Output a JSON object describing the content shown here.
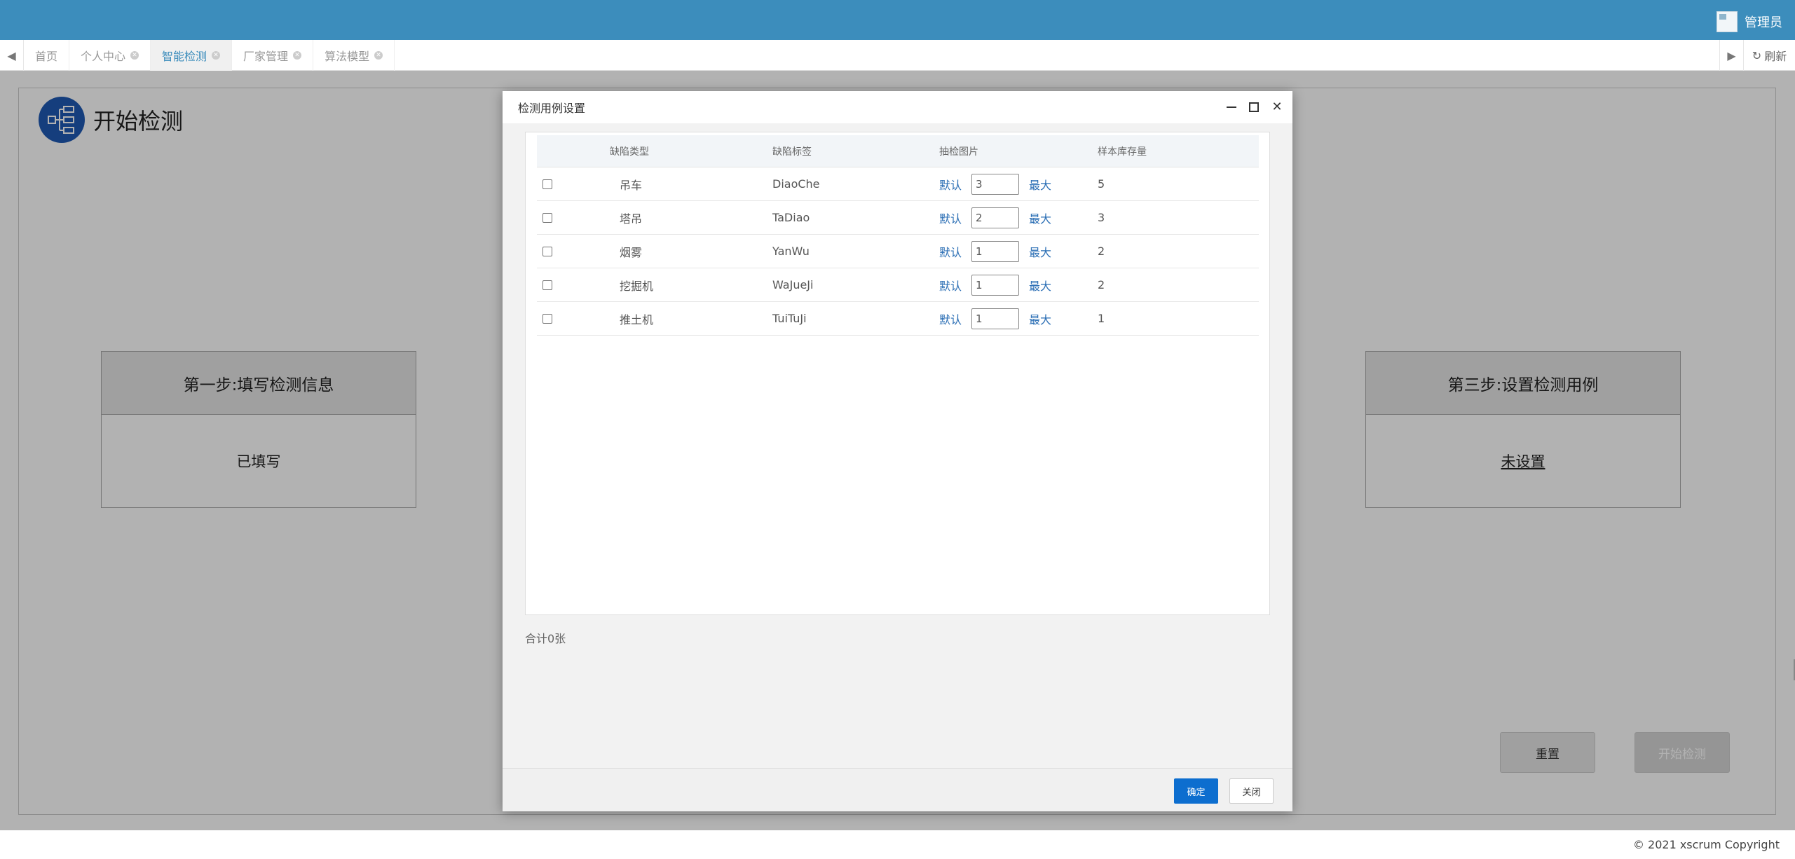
{
  "header": {
    "user_name": "管理员"
  },
  "tabbar": {
    "tabs": [
      {
        "label": "首页"
      },
      {
        "label": "个人中心"
      },
      {
        "label": "智能检测"
      },
      {
        "label": "厂家管理"
      },
      {
        "label": "算法模型"
      }
    ],
    "active_tab": "智能检测",
    "refresh_label": "刷新"
  },
  "main": {
    "title": "开始检测",
    "step1": {
      "title": "第一步:填写检测信息",
      "status": "已填写"
    },
    "step3": {
      "title": "第三步:设置检测用例",
      "status": "未设置"
    },
    "reset_label": "重置",
    "start_label": "开始检测"
  },
  "footer": {
    "copyright": "© 2021 xscrum Copyright"
  },
  "modal": {
    "title": "检测用例设置",
    "columns": {
      "type": "缺陷类型",
      "label": "缺陷标签",
      "sample": "抽检图片",
      "stock": "样本库存量"
    },
    "default_label": "默认",
    "max_label": "最大",
    "rows": [
      {
        "type": "吊车",
        "label": "DiaoChe",
        "sample": "3",
        "stock": "5"
      },
      {
        "type": "塔吊",
        "label": "TaDiao",
        "sample": "2",
        "stock": "3"
      },
      {
        "type": "烟雾",
        "label": "YanWu",
        "sample": "1",
        "stock": "2"
      },
      {
        "type": "挖掘机",
        "label": "WaJueJi",
        "sample": "1",
        "stock": "2"
      },
      {
        "type": "推土机",
        "label": "TuiTuJi",
        "sample": "1",
        "stock": "1"
      }
    ],
    "total": "合计0张",
    "ok_label": "确定",
    "close_label": "关闭"
  },
  "colors": {
    "header_bg": "#3c8dbc",
    "primary_button": "#0d6ecf",
    "link": "#2c6fb5",
    "title_icon": "#1f5ab3"
  }
}
